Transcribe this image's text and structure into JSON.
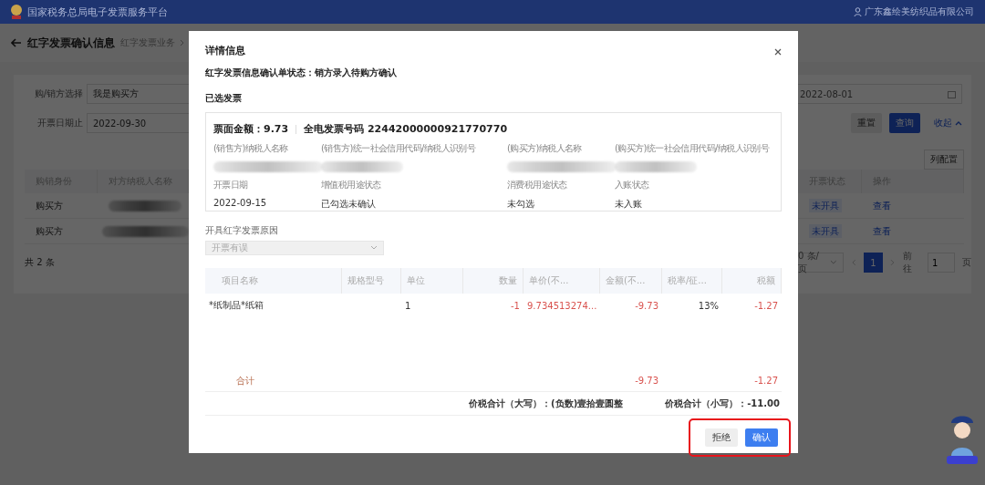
{
  "header": {
    "title": "国家税务总局电子发票服务平台",
    "user": "广东鑫绘美纺织品有限公司"
  },
  "page": {
    "title": "红字发票确认信息",
    "breadcrumb": [
      "红字发票业务"
    ]
  },
  "filters": {
    "fields": [
      {
        "label": "购/销方选择",
        "value": "我是购买方"
      },
      {
        "label": "开票日期止",
        "value": "2022-09-30"
      }
    ],
    "date_start": "2022-08-01",
    "buttons": [
      {
        "label": "重置",
        "kind": "default"
      },
      {
        "label": "查询",
        "kind": "primary"
      },
      {
        "label": "收起",
        "kind": "link"
      }
    ],
    "column_config": "列配置"
  },
  "table": {
    "left_columns": [
      "购销身份",
      "对方纳税人名称"
    ],
    "right_columns": [
      "开票状态",
      "操作"
    ],
    "rows": [
      {
        "role": "购买方",
        "status": "未开具",
        "action": "查看"
      },
      {
        "role": "购买方",
        "status": "未开具",
        "action": "查看"
      }
    ],
    "total": "共 2 条"
  },
  "pagination": {
    "page_size": "0 条/页",
    "pages": [
      {
        "label": "1",
        "selected": true
      }
    ],
    "goto_label": "前往",
    "goto_value": "1",
    "goto_suffix": "页"
  },
  "dialog": {
    "title": "详情信息",
    "status": "红字发票信息确认单状态：销方录入待购方确认",
    "section": "已选发票",
    "invoice": {
      "amount": "票面金额：9.73",
      "number": "全电发票号码 22442000000921770770",
      "fields": [
        {
          "label": "(销售方)纳税人名称"
        },
        {
          "label": "(销售方)统一社会信用代码/纳税人识别号"
        },
        {
          "label": "(购买方)纳税人名称"
        },
        {
          "label": "(购买方)统一社会信用代码/纳税人识别号"
        },
        {
          "label": "开票日期",
          "value": "2022-09-15"
        },
        {
          "label": "增值税用途状态",
          "value": "已勾选未确认"
        },
        {
          "label": "消费税用途状态",
          "value": "未勾选"
        },
        {
          "label": "入账状态",
          "value": "未入账"
        }
      ]
    },
    "reason": {
      "label": "开具红字发票原因",
      "value": "开票有误",
      "disabled": true
    },
    "items": {
      "columns": [
        "项目名称",
        "规格型号",
        "单位",
        "数量",
        "单价(不...",
        "金额(不...",
        "税率/征...",
        "税额"
      ],
      "rows": [
        {
          "cells": [
            "*纸制品*纸箱",
            null,
            "1",
            "-1",
            "9.734513274...",
            "-9.73",
            "13%",
            "-1.27"
          ]
        }
      ],
      "total": {
        "label": "合计",
        "amount": "-9.73",
        "tax": "-1.27"
      }
    },
    "summary": [
      "价税合计（大写）：(负数)壹拾壹圆整",
      "价税合计（小写）：-11.00"
    ],
    "buttons": [
      {
        "label": "拒绝",
        "kind": "default"
      },
      {
        "label": "确认",
        "kind": "primary"
      }
    ],
    "buttons_highlighted": true
  }
}
